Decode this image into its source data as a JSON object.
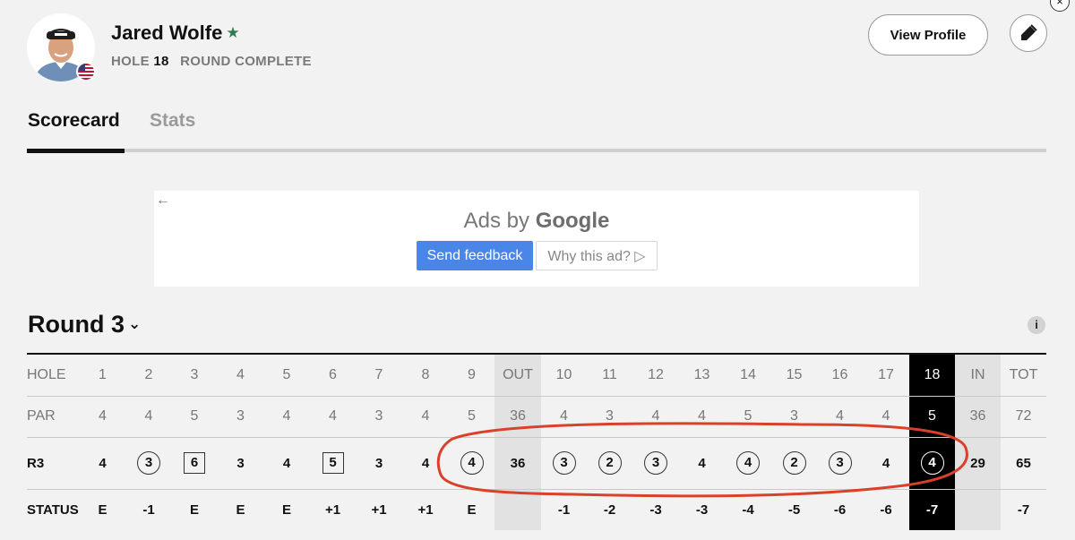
{
  "player": {
    "name": "Jared Wolfe",
    "hole_label": "HOLE",
    "hole_number": "18",
    "round_status": "ROUND COMPLETE",
    "star_color": "#2f7d4f"
  },
  "header": {
    "view_profile_label": "View Profile",
    "close_glyph": "×"
  },
  "tabs": [
    {
      "label": "Scorecard",
      "active": true
    },
    {
      "label": "Stats",
      "active": false
    }
  ],
  "ad": {
    "back_glyph": "←",
    "ads_by": "Ads by",
    "brand": "Google",
    "send_feedback": "Send feedback",
    "why_ad": "Why this ad? ▷",
    "button_color": "#4a86e8"
  },
  "round": {
    "title": "Round 3",
    "chevron": "⌄",
    "info_glyph": "i"
  },
  "scorecard": {
    "rows": [
      {
        "key": "hole",
        "label": "HOLE",
        "cells": [
          "1",
          "2",
          "3",
          "4",
          "5",
          "6",
          "7",
          "8",
          "9",
          "OUT",
          "10",
          "11",
          "12",
          "13",
          "14",
          "15",
          "16",
          "17",
          "18",
          "IN",
          "TOT"
        ]
      },
      {
        "key": "par",
        "label": "PAR",
        "cells": [
          "4",
          "4",
          "5",
          "3",
          "4",
          "4",
          "3",
          "4",
          "5",
          "36",
          "4",
          "3",
          "4",
          "4",
          "5",
          "3",
          "4",
          "4",
          "5",
          "36",
          "72"
        ]
      },
      {
        "key": "r3",
        "label": "R3",
        "cells": [
          "4",
          "3",
          "6",
          "3",
          "4",
          "5",
          "3",
          "4",
          "4",
          "36",
          "3",
          "2",
          "3",
          "4",
          "4",
          "2",
          "3",
          "4",
          "4",
          "29",
          "65"
        ]
      },
      {
        "key": "status",
        "label": "STATUS",
        "cells": [
          "E",
          "-1",
          "E",
          "E",
          "E",
          "+1",
          "+1",
          "+1",
          "E",
          "",
          "-1",
          "-2",
          "-3",
          "-3",
          "-4",
          "-5",
          "-6",
          "-6",
          "-7",
          "",
          "-7"
        ]
      }
    ],
    "r3_marks": [
      "none",
      "circle",
      "square",
      "none",
      "none",
      "square",
      "none",
      "none",
      "circle",
      "none",
      "circle",
      "circle",
      "circle",
      "none",
      "circle",
      "circle",
      "circle",
      "none",
      "circle",
      "none",
      "none"
    ],
    "highlight_col": 18,
    "annotation_color": "#d9412a"
  }
}
